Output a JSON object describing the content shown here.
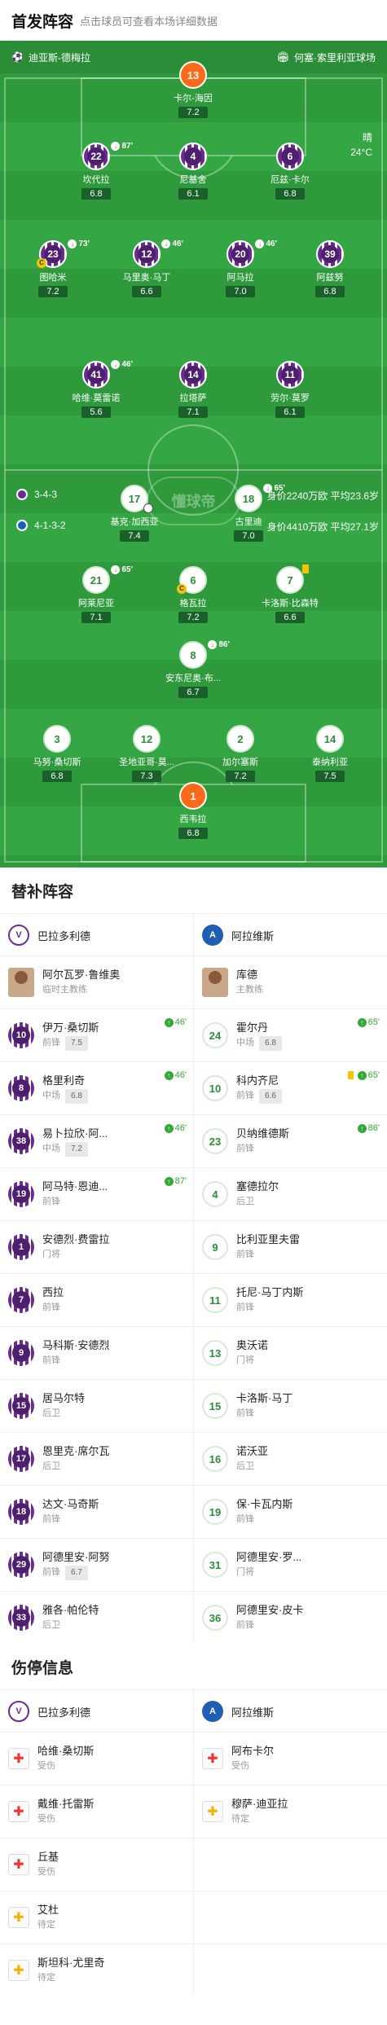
{
  "header": {
    "title": "首发阵容",
    "subtitle": "点击球员可查看本场详细数据"
  },
  "pitch": {
    "home_coach_label": "迪亚斯-德梅拉",
    "venue": "何塞·索里利亚球场",
    "weather": "晴",
    "temp": "24°C",
    "watermark": "懂球帝"
  },
  "home_form": {
    "formation": "3-4-3",
    "value": "身价2240万欧 平均23.6岁"
  },
  "away_form": {
    "formation": "4-1-3-2",
    "value": "身价4410万欧 平均27.1岁"
  },
  "home_players": [
    {
      "num": "13",
      "name": "卡尔-海因",
      "rating": "7.2",
      "gk": true
    },
    {
      "num": "22",
      "name": "坎代拉",
      "rating": "6.8",
      "sub": "87'"
    },
    {
      "num": "4",
      "name": "尼基舍",
      "rating": "6.1"
    },
    {
      "num": "6",
      "name": "厄兹·卡尔",
      "rating": "6.8"
    },
    {
      "num": "23",
      "name": "图哈米",
      "rating": "7.2",
      "sub": "73'",
      "cap": "C"
    },
    {
      "num": "12",
      "name": "马里奥·马丁",
      "rating": "6.6",
      "sub": "46'"
    },
    {
      "num": "20",
      "name": "阿马拉",
      "rating": "7.0",
      "sub": "46'"
    },
    {
      "num": "39",
      "name": "阿兹努",
      "rating": "6.8"
    },
    {
      "num": "41",
      "name": "哈维·莫雷诺",
      "rating": "5.6",
      "sub": "46'"
    },
    {
      "num": "14",
      "name": "拉塔萨",
      "rating": "7.1"
    },
    {
      "num": "11",
      "name": "劳尔·莫罗",
      "rating": "6.1"
    }
  ],
  "away_players": [
    {
      "num": "17",
      "name": "基克·加西亚",
      "rating": "7.4",
      "goal": true
    },
    {
      "num": "18",
      "name": "古里迪",
      "rating": "7.0",
      "sub": "65'"
    },
    {
      "num": "21",
      "name": "阿莱尼亚",
      "rating": "7.1",
      "sub": "65'"
    },
    {
      "num": "6",
      "name": "格瓦拉",
      "rating": "7.2",
      "cap": "C"
    },
    {
      "num": "7",
      "name": "卡洛斯·比森特",
      "rating": "6.6",
      "yellow": true
    },
    {
      "num": "8",
      "name": "安东尼奥·布...",
      "rating": "6.7",
      "sub": "86'"
    },
    {
      "num": "3",
      "name": "马努·桑切斯",
      "rating": "6.8"
    },
    {
      "num": "12",
      "name": "圣地亚哥·莫...",
      "rating": "7.3"
    },
    {
      "num": "2",
      "name": "加尔塞斯",
      "rating": "7.2"
    },
    {
      "num": "14",
      "name": "泰纳利亚",
      "rating": "7.5"
    },
    {
      "num": "1",
      "name": "西韦拉",
      "rating": "6.8",
      "gk": true
    }
  ],
  "subs": {
    "title": "替补阵容",
    "home_team": "巴拉多利德",
    "away_team": "阿拉维斯",
    "home_coach": {
      "name": "阿尔瓦罗·鲁维奥",
      "role": "临时主教练"
    },
    "away_coach": {
      "name": "库德",
      "role": "主教练"
    },
    "rows": [
      [
        {
          "num": "10",
          "name": "伊万·桑切斯",
          "pos": "前锋",
          "rating": "7.5",
          "in": "46'"
        },
        {
          "num": "24",
          "name": "霍尔丹",
          "pos": "中场",
          "rating": "6.8",
          "in": "65'"
        }
      ],
      [
        {
          "num": "8",
          "name": "格里利奇",
          "pos": "中场",
          "rating": "6.8",
          "in": "46'"
        },
        {
          "num": "10",
          "name": "科内齐尼",
          "pos": "前锋",
          "rating": "6.6",
          "in": "65'",
          "yellow": true
        }
      ],
      [
        {
          "num": "38",
          "name": "易卜拉欣·阿...",
          "pos": "中场",
          "rating": "7.2",
          "in": "46'"
        },
        {
          "num": "23",
          "name": "贝纳维德斯",
          "pos": "前锋",
          "in": "86'"
        }
      ],
      [
        {
          "num": "19",
          "name": "阿马特·恩迪...",
          "pos": "前锋",
          "in": "87'"
        },
        {
          "num": "4",
          "name": "塞德拉尔",
          "pos": "后卫"
        }
      ],
      [
        {
          "num": "1",
          "name": "安德烈·费雷拉",
          "pos": "门将"
        },
        {
          "num": "9",
          "name": "比利亚里夫雷",
          "pos": "前锋"
        }
      ],
      [
        {
          "num": "7",
          "name": "西拉",
          "pos": "前锋"
        },
        {
          "num": "11",
          "name": "托尼·马丁内斯",
          "pos": "前锋"
        }
      ],
      [
        {
          "num": "9",
          "name": "马科斯·安德烈",
          "pos": "前锋"
        },
        {
          "num": "13",
          "name": "奥沃诺",
          "pos": "门将"
        }
      ],
      [
        {
          "num": "15",
          "name": "居马尔特",
          "pos": "后卫"
        },
        {
          "num": "15",
          "name": "卡洛斯·马丁",
          "pos": "前锋"
        }
      ],
      [
        {
          "num": "17",
          "name": "恩里克·席尔瓦",
          "pos": "后卫"
        },
        {
          "num": "16",
          "name": "诺沃亚",
          "pos": "后卫"
        }
      ],
      [
        {
          "num": "18",
          "name": "达文·马奇斯",
          "pos": "前锋"
        },
        {
          "num": "19",
          "name": "保·卡瓦内斯",
          "pos": "前锋"
        }
      ],
      [
        {
          "num": "29",
          "name": "阿德里安·阿努",
          "pos": "前锋",
          "rating": "6.7"
        },
        {
          "num": "31",
          "name": "阿德里安·罗...",
          "pos": "门将"
        }
      ],
      [
        {
          "num": "33",
          "name": "雅各·帕伦特",
          "pos": "后卫"
        },
        {
          "num": "36",
          "name": "阿德里安·皮卡",
          "pos": "前锋"
        }
      ]
    ]
  },
  "injuries": {
    "title": "伤停信息",
    "rows": [
      [
        {
          "name": "哈维·桑切斯",
          "status": "受伤",
          "type": "red"
        },
        {
          "name": "阿布卡尔",
          "status": "受伤",
          "type": "red"
        }
      ],
      [
        {
          "name": "戴维·托雷斯",
          "status": "受伤",
          "type": "red"
        },
        {
          "name": "穆萨·迪亚拉",
          "status": "待定",
          "type": "yel"
        }
      ],
      [
        {
          "name": "丘基",
          "status": "受伤",
          "type": "red"
        },
        null
      ],
      [
        {
          "name": "艾杜",
          "status": "待定",
          "type": "yel"
        },
        null
      ],
      [
        {
          "name": "斯坦科·尤里奇",
          "status": "待定",
          "type": "yel"
        },
        null
      ]
    ]
  }
}
